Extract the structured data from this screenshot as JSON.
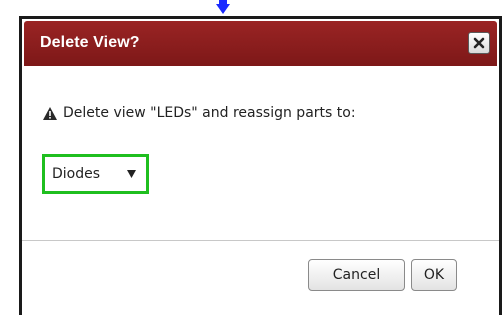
{
  "dialog": {
    "title": "Delete View?",
    "close_label": "×",
    "message": "Delete view \"LEDs\" and reassign parts to:",
    "icons": {
      "warning": "warning-icon",
      "close": "close-icon",
      "caret": "caret-down-icon",
      "pointer": "arrow-down-icon"
    },
    "select": {
      "value": "Diodes"
    },
    "buttons": {
      "cancel_label": "Cancel",
      "ok_label": "OK"
    }
  },
  "colors": {
    "titlebar": "#8a1d1d",
    "highlight": "#1fbf1f",
    "pointer": "#1a2bff"
  }
}
